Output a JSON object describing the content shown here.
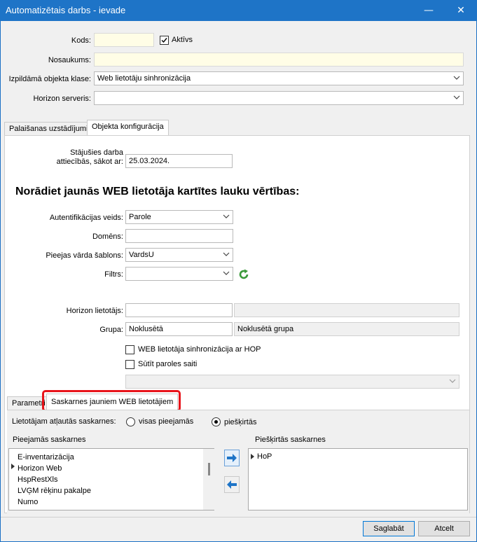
{
  "window": {
    "title": "Automatizētais darbs - ievade",
    "minimize": "—",
    "close": "✕"
  },
  "header": {
    "kods_label": "Kods:",
    "kods_value": "",
    "aktivs_label": "Aktīvs",
    "aktivs_checked": true,
    "nosaukums_label": "Nosaukums:",
    "nosaukums_value": "",
    "klase_label": "Izpildāmā objekta klase:",
    "klase_value": "Web lietotāju sinhronizācija",
    "serveris_label": "Horizon serveris:",
    "serveris_value": ""
  },
  "tabs": [
    {
      "label": "Palaišanas uzstādījumi",
      "active": false
    },
    {
      "label": "Objekta konfigurācija",
      "active": true
    }
  ],
  "config": {
    "date_label": "Stājušies darba attiecībās, sākot ar:",
    "date_value": "25.03.2024.",
    "heading": "Norādiet jaunās WEB lietotāja kartītes lauku vērtības:",
    "auth_label": "Autentifikācijas veids:",
    "auth_value": "Parole",
    "domain_label": "Domēns:",
    "domain_value": "",
    "template_label": "Pieejas vārda šablons:",
    "template_value": "VardsU",
    "filter_label": "Filtrs:",
    "filter_value": "",
    "user_label": "Horizon lietotājs:",
    "user_value": "",
    "user_name": "",
    "group_label": "Grupa:",
    "group_value": "Noklusētā",
    "group_name": "Noklusētā grupa",
    "sync_label": "WEB lietotāja sinhronizācija ar HOP",
    "send_label": "Sūtīt paroles saiti",
    "bottom_select": ""
  },
  "subtabs": [
    {
      "label": "Parametri",
      "active": false
    },
    {
      "label": "Saskarnes jauniem WEB lietotājiem",
      "active": true
    }
  ],
  "interfaces": {
    "allowed_label": "Lietotājam atļautās saskarnes:",
    "radio_all": "visas pieejamās",
    "radio_assigned": "piešķirtās",
    "selected_radio": "piešķirtās",
    "available_title": "Pieejamās saskarnes",
    "assigned_title": "Piešķirtās saskarnes",
    "available": [
      "E-inventarizācija",
      "Horizon Web",
      "HspRestXls",
      "LVĢM rēķinu pakalpe",
      "Numo"
    ],
    "assigned": [
      "HoP"
    ]
  },
  "footer": {
    "save": "Saglabāt",
    "cancel": "Atcelt"
  },
  "colors": {
    "titlebar": "#1e74c7",
    "highlight": "#e8141b",
    "refresh": "#3a9a3a",
    "arrow": "#1e74c7"
  }
}
